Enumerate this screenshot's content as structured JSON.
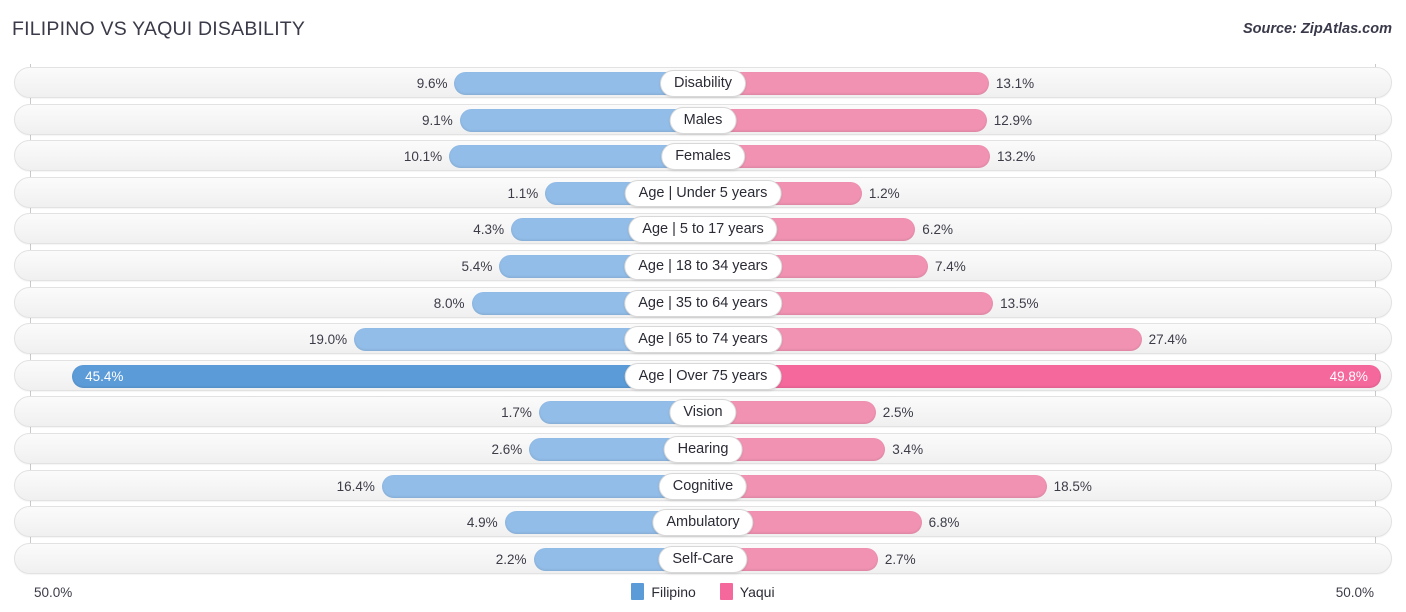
{
  "header": {
    "title": "FILIPINO VS YAQUI DISABILITY",
    "source": "Source: ZipAtlas.com"
  },
  "legend": {
    "items": [
      {
        "label": "Filipino",
        "color": "#5b9bd8"
      },
      {
        "label": "Yaqui",
        "color": "#f4689c"
      }
    ]
  },
  "axis": {
    "left_label": "50.0%",
    "right_label": "50.0%",
    "max": 50.0
  },
  "chart_data": {
    "type": "bar",
    "title": "FILIPINO VS YAQUI DISABILITY",
    "orientation": "horizontal-diverging",
    "xlabel": "",
    "ylabel": "",
    "xlim": [
      50.0,
      50.0
    ],
    "grid": true,
    "legend_position": "bottom-center",
    "categories": [
      "Disability",
      "Males",
      "Females",
      "Age | Under 5 years",
      "Age | 5 to 17 years",
      "Age | 18 to 34 years",
      "Age | 35 to 64 years",
      "Age | 65 to 74 years",
      "Age | Over 75 years",
      "Vision",
      "Hearing",
      "Cognitive",
      "Ambulatory",
      "Self-Care"
    ],
    "series": [
      {
        "name": "Filipino",
        "color": "#92bde8",
        "values": [
          9.6,
          9.1,
          10.1,
          1.1,
          4.3,
          5.4,
          8.0,
          19.0,
          45.4,
          1.7,
          2.6,
          16.4,
          4.9,
          2.2
        ]
      },
      {
        "name": "Yaqui",
        "color": "#f192b3",
        "values": [
          13.1,
          12.9,
          13.2,
          1.2,
          6.2,
          7.4,
          13.5,
          27.4,
          49.8,
          2.5,
          3.4,
          18.5,
          6.8,
          2.7
        ]
      }
    ],
    "highlight_row": "Age | Over 75 years"
  },
  "rows": [
    {
      "category": "Disability",
      "left_value": "9.6%",
      "right_value": "13.1%",
      "left_num": 9.6,
      "right_num": 13.1,
      "highlight": false
    },
    {
      "category": "Males",
      "left_value": "9.1%",
      "right_value": "12.9%",
      "left_num": 9.1,
      "right_num": 12.9,
      "highlight": false
    },
    {
      "category": "Females",
      "left_value": "10.1%",
      "right_value": "13.2%",
      "left_num": 10.1,
      "right_num": 13.2,
      "highlight": false
    },
    {
      "category": "Age | Under 5 years",
      "left_value": "1.1%",
      "right_value": "1.2%",
      "left_num": 1.1,
      "right_num": 1.2,
      "highlight": false
    },
    {
      "category": "Age | 5 to 17 years",
      "left_value": "4.3%",
      "right_value": "6.2%",
      "left_num": 4.3,
      "right_num": 6.2,
      "highlight": false
    },
    {
      "category": "Age | 18 to 34 years",
      "left_value": "5.4%",
      "right_value": "7.4%",
      "left_num": 5.4,
      "right_num": 7.4,
      "highlight": false
    },
    {
      "category": "Age | 35 to 64 years",
      "left_value": "8.0%",
      "right_value": "13.5%",
      "left_num": 8.0,
      "right_num": 13.5,
      "highlight": false
    },
    {
      "category": "Age | 65 to 74 years",
      "left_value": "19.0%",
      "right_value": "27.4%",
      "left_num": 19.0,
      "right_num": 27.4,
      "highlight": false
    },
    {
      "category": "Age | Over 75 years",
      "left_value": "45.4%",
      "right_value": "49.8%",
      "left_num": 45.4,
      "right_num": 49.8,
      "highlight": true
    },
    {
      "category": "Vision",
      "left_value": "1.7%",
      "right_value": "2.5%",
      "left_num": 1.7,
      "right_num": 2.5,
      "highlight": false
    },
    {
      "category": "Hearing",
      "left_value": "2.6%",
      "right_value": "3.4%",
      "left_num": 2.6,
      "right_num": 3.4,
      "highlight": false
    },
    {
      "category": "Cognitive",
      "left_value": "16.4%",
      "right_value": "18.5%",
      "left_num": 16.4,
      "right_num": 18.5,
      "highlight": false
    },
    {
      "category": "Ambulatory",
      "left_value": "4.9%",
      "right_value": "6.8%",
      "left_num": 4.9,
      "right_num": 6.8,
      "highlight": false
    },
    {
      "category": "Self-Care",
      "left_value": "2.2%",
      "right_value": "2.7%",
      "left_num": 2.2,
      "right_num": 2.7,
      "highlight": false
    }
  ]
}
